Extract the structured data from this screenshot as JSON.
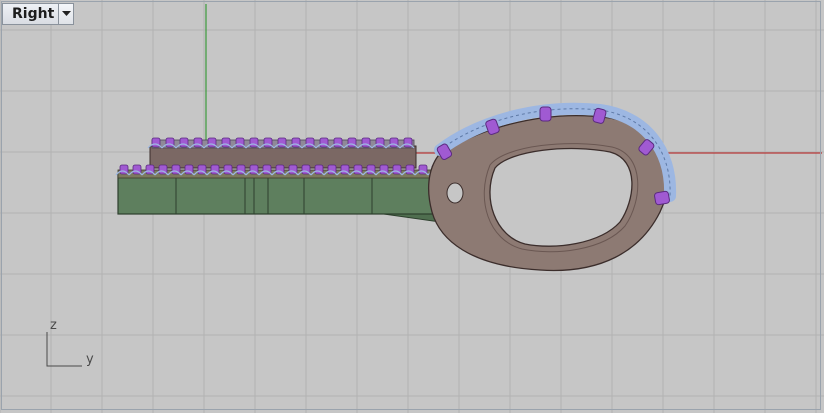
{
  "viewport": {
    "name": "Right",
    "dropdown_icon": "chevron-down-icon",
    "background_color": "#c6c6c6",
    "grid_color": "#b2b2b2",
    "grid_major_color": "#a6a6a6",
    "x_axis_color": "#b83a3a",
    "y_axis_color": "#3c9a3c"
  },
  "axes_indicator": {
    "vertical_label": "z",
    "horizontal_label": "y"
  },
  "model": {
    "description_colors": {
      "base_green": "#5a7a5a",
      "shank_brown": "#7d6a64",
      "setting_blue": "#9db7e2",
      "gem_purple": "#a05ad2"
    }
  }
}
